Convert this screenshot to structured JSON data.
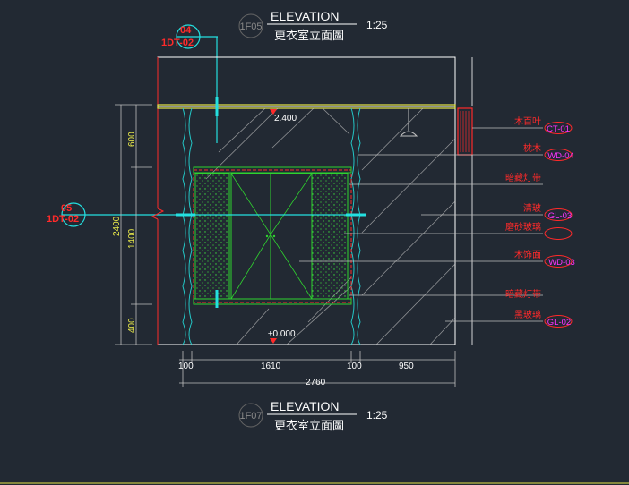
{
  "title_top": {
    "code": "1F05",
    "heading": "ELEVATION",
    "subtitle": "更衣室立面圖",
    "scale": "1:25"
  },
  "title_bottom": {
    "code": "1F07",
    "heading": "ELEVATION",
    "subtitle": "更衣室立面圖",
    "scale": "1:25"
  },
  "section_markers": [
    {
      "number": "04",
      "ref": "1DT-02"
    },
    {
      "number": "05",
      "ref": "1DT-02"
    }
  ],
  "levels": {
    "ceiling": "2.400",
    "floor": "±0.000"
  },
  "dimensions": {
    "vertical": [
      "600",
      "1400",
      "400",
      "2400"
    ],
    "horizontal": [
      "100",
      "1610",
      "100",
      "950"
    ],
    "total": "2760"
  },
  "callouts": [
    {
      "label": "木百叶",
      "code": "CT-01"
    },
    {
      "label": "枕木",
      "code": "WD-04"
    },
    {
      "label": "暗藏灯带",
      "code": ""
    },
    {
      "label": "清玻",
      "code": "GL-03"
    },
    {
      "label": "磨砂玻璃",
      "code": ""
    },
    {
      "label": "木饰面",
      "code": "WD-03"
    },
    {
      "label": "暗藏灯带",
      "code": ""
    },
    {
      "label": "黑玻璃",
      "code": "GL-02"
    }
  ]
}
